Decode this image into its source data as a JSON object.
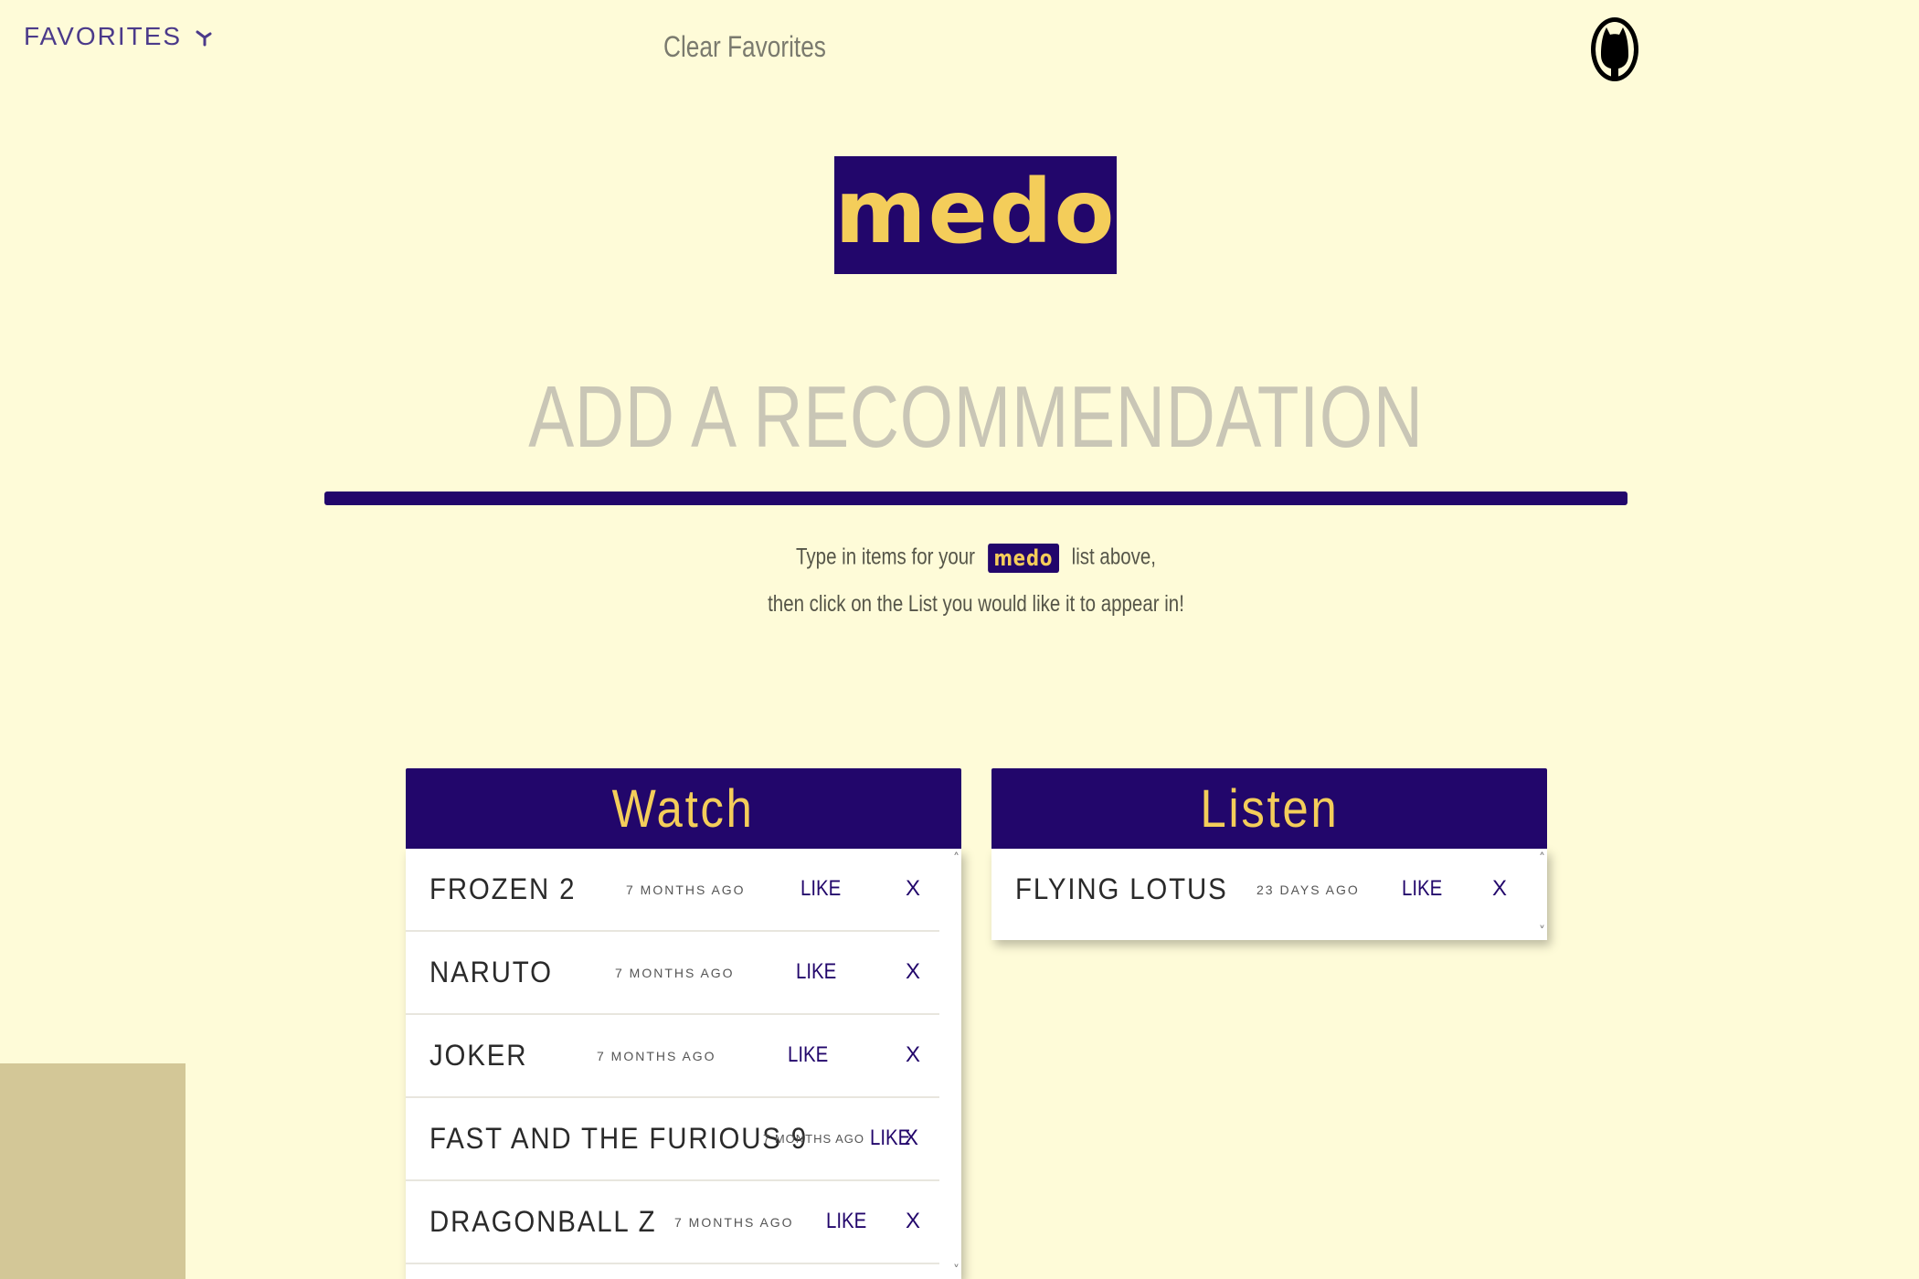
{
  "nav": {
    "favorites_label": "FAVORITES",
    "clear_favorites_label": "Clear Favorites"
  },
  "brand": {
    "logo_text": "medo",
    "logo_bg": "#22066b",
    "logo_fg": "#f4cd5a"
  },
  "hero": {
    "title": "ADD A RECOMMENDATION",
    "instruction_before": "Type in items for your",
    "instruction_logo": "medo",
    "instruction_after": "list above,",
    "instruction_line2": "then click on the List you would like it to appear in!"
  },
  "lists": {
    "watch": {
      "title": "Watch",
      "items": [
        {
          "title": "FROZEN 2",
          "time": "7 MONTHS AGO",
          "like": "LIKE",
          "remove": "X"
        },
        {
          "title": "NARUTO",
          "time": "7 MONTHS AGO",
          "like": "LIKE",
          "remove": "X"
        },
        {
          "title": "JOKER",
          "time": "7 MONTHS AGO",
          "like": "LIKE",
          "remove": "X"
        },
        {
          "title": "FAST AND THE FURIOUS 9",
          "time": "7 MONTHS AGO",
          "like": "LIKE",
          "remove": "X"
        },
        {
          "title": "DRAGONBALL Z",
          "time": "7 MONTHS AGO",
          "like": "LIKE",
          "remove": "X"
        }
      ]
    },
    "listen": {
      "title": "Listen",
      "items": [
        {
          "title": "FLYING LOTUS",
          "time": "23 DAYS AGO",
          "like": "LIKE",
          "remove": "X"
        }
      ]
    }
  },
  "colors": {
    "background": "#fefbd8",
    "accent": "#22066b",
    "gold": "#f4cd5a"
  }
}
